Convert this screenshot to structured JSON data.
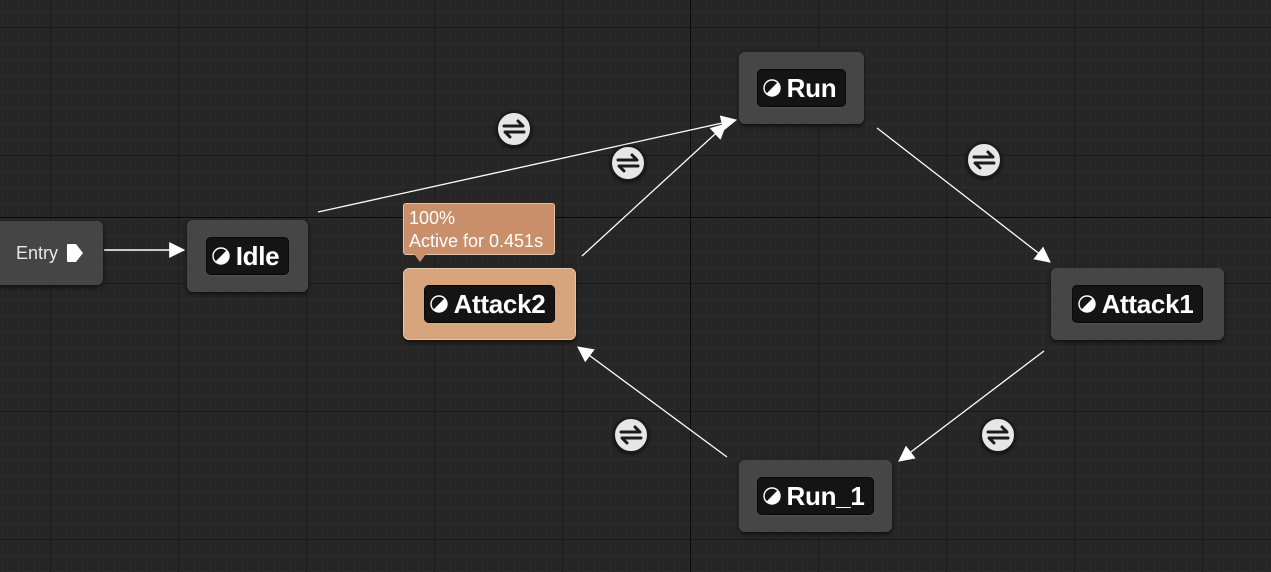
{
  "entry": {
    "label": "Entry",
    "pin_icon": "exec-pin-icon"
  },
  "states": {
    "idle": {
      "label": "Idle",
      "icon": "state-icon"
    },
    "run": {
      "label": "Run",
      "icon": "state-icon"
    },
    "attack2": {
      "label": "Attack2",
      "icon": "state-icon",
      "active": true
    },
    "attack1": {
      "label": "Attack1",
      "icon": "state-icon"
    },
    "run_1": {
      "label": "Run_1",
      "icon": "state-icon"
    }
  },
  "active_tooltip": {
    "weight": "100%",
    "active_time": "Active for 0.451s"
  },
  "transitions": [
    {
      "from": "Idle",
      "to": "Run",
      "icon": "transition-rule-icon"
    },
    {
      "from": "Attack2",
      "to": "Run",
      "icon": "transition-rule-icon"
    },
    {
      "from": "Run",
      "to": "Attack1",
      "icon": "transition-rule-icon"
    },
    {
      "from": "Attack1",
      "to": "Run_1",
      "icon": "transition-rule-icon"
    },
    {
      "from": "Run_1",
      "to": "Attack2",
      "icon": "transition-rule-icon"
    }
  ],
  "colors": {
    "background": "#262626",
    "node": "#464646",
    "node_inner": "#141414",
    "active_node": "#d7a47e",
    "tooltip": "#c98f6b",
    "wire": "#ffffff"
  }
}
